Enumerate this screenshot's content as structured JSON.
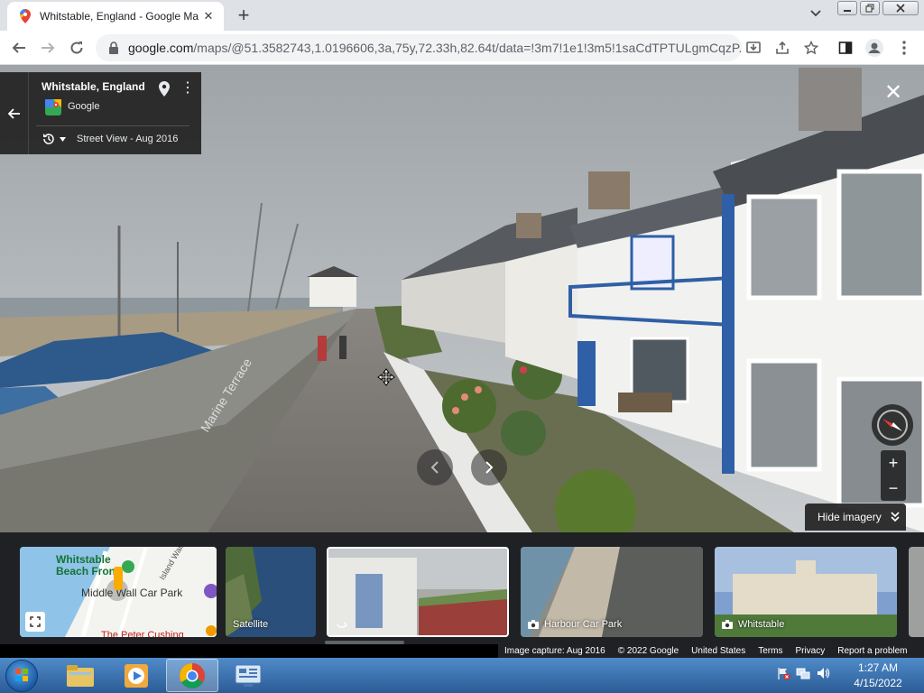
{
  "browser": {
    "tab_title": "Whitstable, England - Google Ma",
    "url_host": "google.com",
    "url_path": "/maps/@51.3582743,1.0196606,3a,75y,72.33h,82.64t/data=!3m7!1e1!3m5!1saCdTPTULgmCqzP...",
    "icons": [
      "maps-favicon",
      "close-icon",
      "plus-icon",
      "chevron-down-icon",
      "minimize-icon",
      "restore-icon",
      "close-icon",
      "back-arrow-icon",
      "forward-arrow-icon",
      "reload-icon",
      "lock-icon",
      "download-icon",
      "share-icon",
      "star-icon",
      "sidebar-icon",
      "profile-icon",
      "kebab-menu-icon"
    ]
  },
  "streetview": {
    "place_name": "Whitstable, England",
    "source_name": "Google",
    "history_label": "Street View - Aug 2016",
    "hide_imagery_label": "Hide imagery",
    "zoom_in_label": "+",
    "zoom_out_label": "−",
    "road_marking_text": "Marine Terrace",
    "colors": {
      "panel": "#222222",
      "sky": "#b9bec2",
      "wall": "#8d8d88",
      "house_trim": "#2f5fa6"
    }
  },
  "filmstrip": {
    "map_thumb": {
      "label_beach": "Whitstable Beach Front",
      "label_carpark": "Middle Wall Car Park",
      "label_street": "Island Wall",
      "label_bottom": "The Peter Cushing"
    },
    "items": [
      {
        "label": "Satellite"
      },
      {
        "label": ""
      },
      {
        "label": "Harbour Car Park"
      },
      {
        "label": "Whitstable"
      }
    ]
  },
  "attribution": {
    "capture": "Image capture: Aug 2016",
    "copyright": "© 2022 Google",
    "country": "United States",
    "terms": "Terms",
    "privacy": "Privacy",
    "report": "Report a problem"
  },
  "taskbar": {
    "time": "1:27 AM",
    "date": "4/15/2022",
    "apps": [
      "file-explorer",
      "media-player",
      "chrome",
      "control-panel"
    ]
  }
}
